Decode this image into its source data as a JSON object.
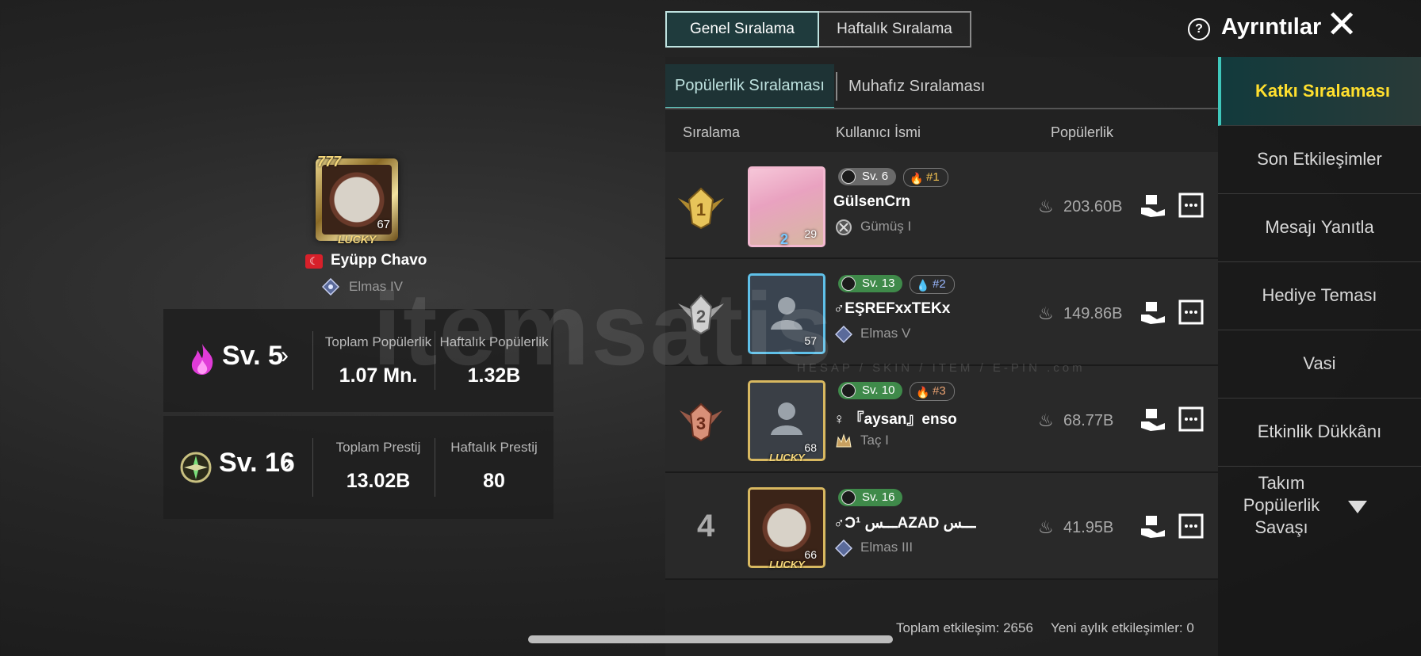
{
  "profile": {
    "name": "Eyüpp  Chavo",
    "avatar_level": "67",
    "frame_text": "LUCKY",
    "frame_top": "777",
    "tier": "Elmas IV"
  },
  "stats": {
    "popularity": {
      "level": "Sv. 5",
      "total_label": "Toplam Popülerlik",
      "total_value": "1.07 Mn.",
      "weekly_label": "Haftalık Popülerlik",
      "weekly_value": "1.32B"
    },
    "prestige": {
      "level": "Sv. 16",
      "total_label": "Toplam Prestij",
      "total_value": "13.02B",
      "weekly_label": "Haftalık Prestij",
      "weekly_value": "80"
    }
  },
  "top_tabs": [
    "Genel Sıralama",
    "Haftalık Sıralama"
  ],
  "details_label": "Ayrıntılar",
  "sub_tabs": [
    "Popülerlik Sıralaması",
    "Muhafız Sıralaması"
  ],
  "columns": {
    "rank": "Sıralama",
    "user": "Kullanıcı İsmi",
    "popularity": "Popülerlik"
  },
  "rows": [
    {
      "rank": "1",
      "avatar_level": "29",
      "avatar_badge": "2",
      "sv": "Sv. 6",
      "rank_tag": "#1",
      "name": "GülsenCrn",
      "tier": "Gümüş I",
      "popularity": "203.60B"
    },
    {
      "rank": "2",
      "avatar_level": "57",
      "sv": "Sv. 13",
      "rank_tag": "#2",
      "name": "♂EŞREFxxTEKx",
      "tier": "Elmas V",
      "popularity": "149.86B"
    },
    {
      "rank": "3",
      "avatar_level": "68",
      "avatar_badge": "LUCKY",
      "sv": "Sv. 10",
      "rank_tag": "#3",
      "name": "♀ 『aysan』enso",
      "tier": "Taç I",
      "popularity": "68.77B"
    },
    {
      "rank": "4",
      "avatar_level": "66",
      "avatar_badge": "LUCKY",
      "sv": "Sv. 16",
      "name": "♂Ͻ¹ ـــسAZAD ـــس",
      "tier": "Elmas III",
      "popularity": "41.95B"
    }
  ],
  "footer": {
    "total": "Toplam etkileşim: 2656",
    "monthly": "Yeni aylık etkileşimler: 0"
  },
  "menu": [
    "Katkı Sıralaması",
    "Son Etkileşimler",
    "Mesajı Yanıtla",
    "Hediye Teması",
    "Vasi",
    "Etkinlik Dükkânı"
  ],
  "menu_multi": [
    "Takım",
    "Popülerlik",
    "Savaşı"
  ],
  "watermark": {
    "main": "itemsatis",
    "sub": "HESAP / SKIN / ITEM / E-PIN .com"
  },
  "colors": {
    "accent": "#3fc8bc",
    "active_menu_text": "#ffdf2e",
    "level_green": "#3f8a4a"
  }
}
